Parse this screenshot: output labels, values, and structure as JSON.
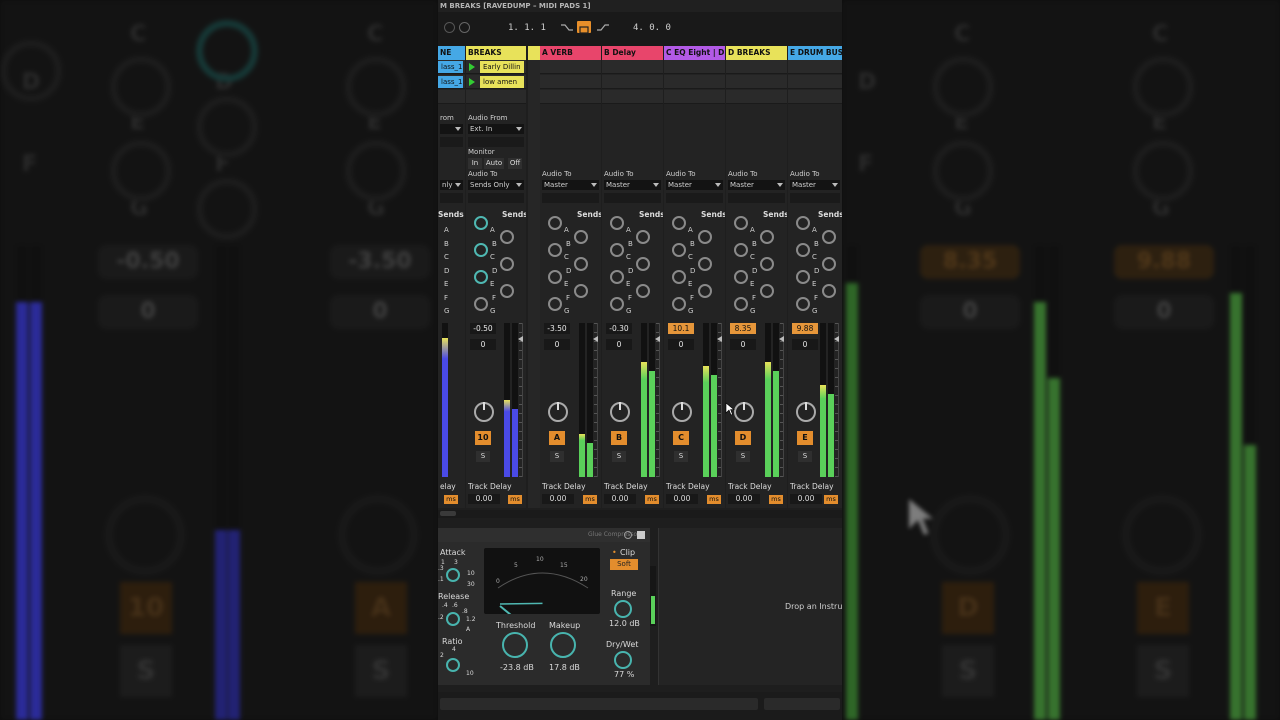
{
  "window": {
    "title": "M BREAKS [RAVEDUMP – MIDI PADS 1]"
  },
  "transport": {
    "position": "1.   1.   1",
    "end": "4.   0.   0"
  },
  "tracks": [
    {
      "name": "NE",
      "color": "#45a8e6",
      "clips": [
        "lass_13",
        "lass_13"
      ],
      "ab": "8",
      "audio_from": "rom",
      "audio_to": "",
      "to_value": "nly",
      "volume": "",
      "pan_value": "",
      "button": "",
      "delay_label": "elay",
      "delay_value": ""
    },
    {
      "name": "BREAKS",
      "color": "#e8e25a",
      "clips": [
        "Early Dillin",
        "low amen"
      ],
      "ab": "7",
      "ab2": "4",
      "audio_from": "Audio From",
      "from_value": "Ext. In",
      "monitor": "Monitor",
      "mon_in": "In",
      "mon_auto": "Auto",
      "mon_off": "Off",
      "audio_to": "Audio To",
      "to_value": "Sends Only",
      "volume": "-0.50",
      "pan_value": "0",
      "button": "10",
      "delay_label": "Track Delay",
      "delay_value": "0.00"
    },
    {
      "name": "A VERB",
      "color": "#e8456b",
      "audio_to": "Audio To",
      "to_value": "Master",
      "volume": "-3.50",
      "volume_orange": false,
      "pan_value": "0",
      "button": "A",
      "delay_label": "Track Delay",
      "delay_value": "0.00"
    },
    {
      "name": "B Delay",
      "color": "#e8456b",
      "audio_to": "Audio To",
      "to_value": "Master",
      "volume": "-0.30",
      "volume_orange": false,
      "pan_value": "0",
      "button": "B",
      "delay_label": "Track Delay",
      "delay_value": "0.00"
    },
    {
      "name": "C EQ Eight | D",
      "color": "#b25ae6",
      "audio_to": "Audio To",
      "to_value": "Master",
      "volume": "10.1",
      "volume_orange": true,
      "pan_value": "0",
      "button": "C",
      "delay_label": "Track Delay",
      "delay_value": "0.00"
    },
    {
      "name": "D BREAKS",
      "color": "#e8e25a",
      "audio_to": "Audio To",
      "to_value": "Master",
      "volume": "8.35",
      "volume_orange": true,
      "pan_value": "0",
      "button": "D",
      "delay_label": "Track Delay",
      "delay_value": "0.00"
    },
    {
      "name": "E DRUM BUS",
      "color": "#45a8e6",
      "audio_to": "Audio To",
      "to_value": "Master",
      "volume": "9.88",
      "volume_orange": true,
      "pan_value": "0",
      "button": "E",
      "delay_label": "Track Delay",
      "delay_value": "0.00"
    }
  ],
  "sends_label": "Sends",
  "send_letters": [
    "A",
    "B",
    "C",
    "D",
    "E",
    "F",
    "G"
  ],
  "solo_label": "S",
  "ms_label": "ms",
  "device": {
    "name": "Glue Compressor",
    "attack_label": "Attack",
    "attack_ticks": [
      "1",
      "3",
      "10",
      "30",
      ".3",
      ".1"
    ],
    "release_label": "Release",
    "release_ticks": [
      ".4",
      ".6",
      ".8",
      "1.2",
      ".2",
      "A"
    ],
    "ratio_label": "Ratio",
    "ratio_ticks": [
      "4",
      "2",
      "10"
    ],
    "meter_scale": [
      "0",
      "5",
      "10",
      "15",
      "20"
    ],
    "threshold_label": "Threshold",
    "threshold_value": "-23.8 dB",
    "makeup_label": "Makeup",
    "makeup_value": "17.8 dB",
    "clip_label": "Clip",
    "soft_label": "Soft",
    "range_label": "Range",
    "range_value": "12.0 dB",
    "drywet_label": "Dry/Wet",
    "drywet_value": "77 %"
  },
  "dropzone": {
    "text": "Drop an Instru"
  },
  "background": {
    "letters": [
      "C",
      "D",
      "E",
      "F",
      "G"
    ],
    "left_values": [
      "-0.50",
      "-3.50"
    ],
    "left_pans": [
      "0",
      "0"
    ],
    "left_buttons": [
      "10",
      "A"
    ],
    "right_values": [
      "8.35",
      "9.88"
    ],
    "right_pans": [
      "0",
      "0"
    ],
    "right_buttons": [
      "D",
      "E"
    ],
    "solo": "S"
  }
}
